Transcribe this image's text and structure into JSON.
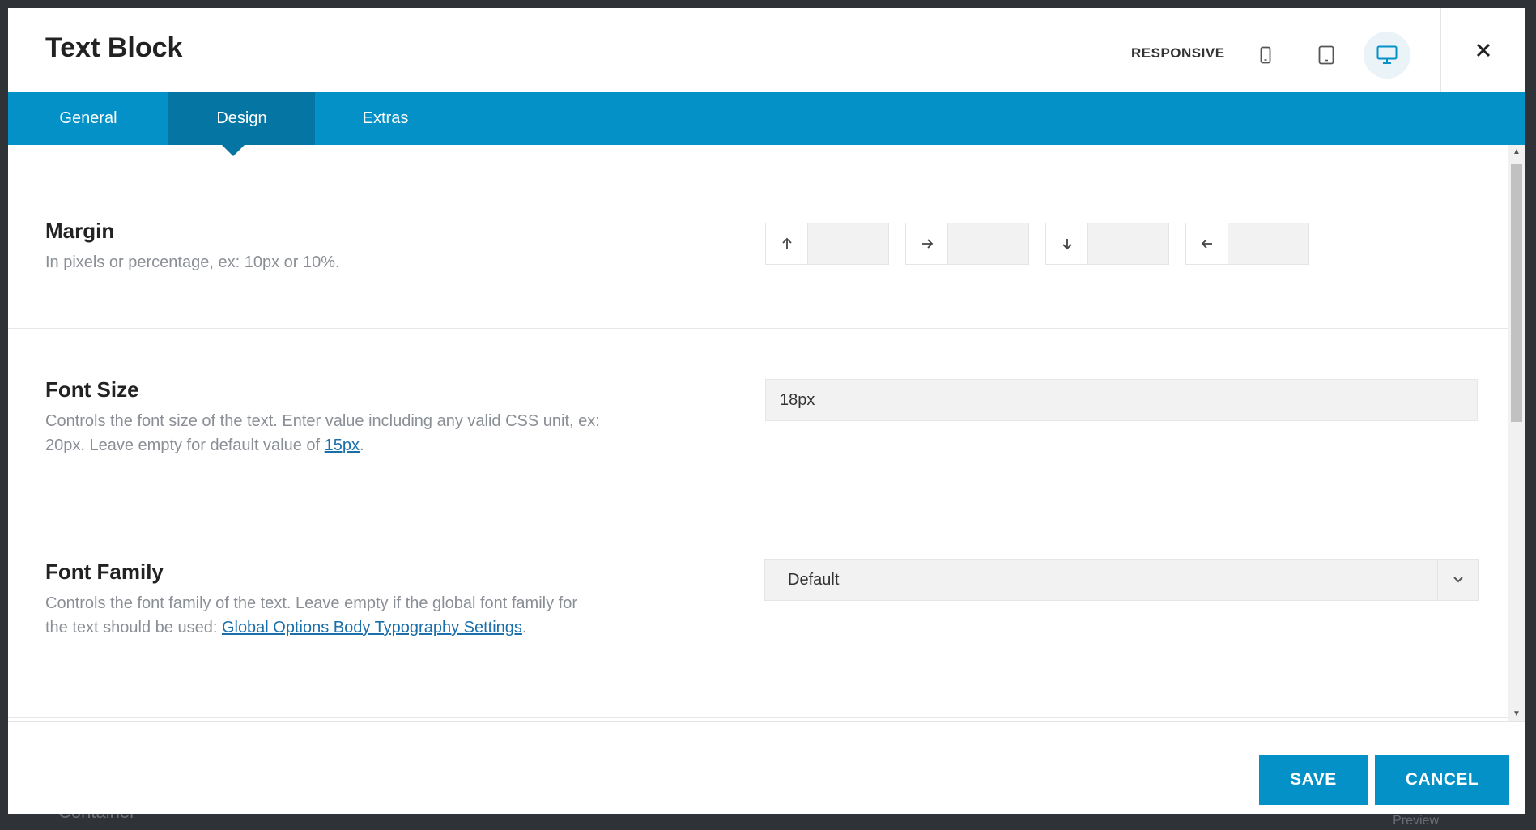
{
  "backdrop": {
    "left_text": "Container",
    "right_text": "Preview"
  },
  "header": {
    "title": "Text Block",
    "responsive_label": "RESPONSIVE",
    "devices": [
      {
        "name": "mobile",
        "icon": "mobile-icon",
        "active": false
      },
      {
        "name": "tablet",
        "icon": "tablet-icon",
        "active": false
      },
      {
        "name": "desktop",
        "icon": "desktop-icon",
        "active": true
      }
    ],
    "close_icon": "close-icon"
  },
  "tabs": [
    {
      "label": "General",
      "active": false
    },
    {
      "label": "Design",
      "active": true
    },
    {
      "label": "Extras",
      "active": false
    }
  ],
  "sections": {
    "margin": {
      "title": "Margin",
      "description": "In pixels or percentage, ex: 10px or 10%.",
      "fields": [
        {
          "side": "top",
          "icon": "arrow-up-icon",
          "value": ""
        },
        {
          "side": "right",
          "icon": "arrow-right-icon",
          "value": ""
        },
        {
          "side": "bottom",
          "icon": "arrow-down-icon",
          "value": ""
        },
        {
          "side": "left",
          "icon": "arrow-left-icon",
          "value": ""
        }
      ]
    },
    "font_size": {
      "title": "Font Size",
      "description_part1": "Controls the font size of the text. Enter value including any valid CSS unit, ex: 20px. Leave empty for default value of ",
      "description_link": "15px",
      "description_part2": ".",
      "value": "18px"
    },
    "font_family": {
      "title": "Font Family",
      "description_part1": "Controls the font family of the text. Leave empty if the global font family for the text should be used: ",
      "description_link": "Global Options Body Typography Settings",
      "description_part2": ".",
      "selected": "Default"
    }
  },
  "footer": {
    "save_label": "SAVE",
    "cancel_label": "CANCEL"
  },
  "colors": {
    "accent": "#0391c7",
    "accent_dark": "#0575a3",
    "link": "#1a6faa"
  }
}
